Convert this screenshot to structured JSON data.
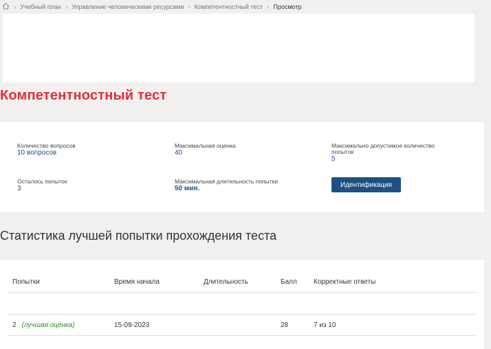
{
  "breadcrumb": {
    "items": [
      "Учебный план",
      "Управление человеческими ресурсами",
      "Компетентностный тест"
    ],
    "current": "Просмотр"
  },
  "page": {
    "title": "Компетентностный тест"
  },
  "info": {
    "questions_label": "Количество вопросов",
    "questions_value": "10 вопросов",
    "max_score_label": "Максимальная оценка",
    "max_score_value": "40",
    "max_attempts_label_1": "Максимально допустимое количество",
    "max_attempts_label_2": "попыток",
    "max_attempts_value": "5",
    "remaining_label": "Осталось попыток",
    "remaining_value": "3",
    "max_duration_label": "Максимальная длительность попытки",
    "max_duration_value": "50 мин.",
    "identify_button": "Идентификация"
  },
  "stats": {
    "title": "Статистика лучшей попытки прохождения теста",
    "columns": [
      "Попытки",
      "Время начала",
      "Длительность",
      "Балл",
      "Корректные ответы"
    ],
    "rows": [
      {
        "attempt": "2",
        "badge": "(лучшая оценка)",
        "start": "15-09-2023",
        "duration": "",
        "score": "28",
        "correct": "7 из 10"
      }
    ]
  },
  "colors": {
    "accent_red": "#e52d3a",
    "button_blue": "#1e5183",
    "value_blue": "#1f4f7f",
    "best_green": "#2e8b2e"
  }
}
